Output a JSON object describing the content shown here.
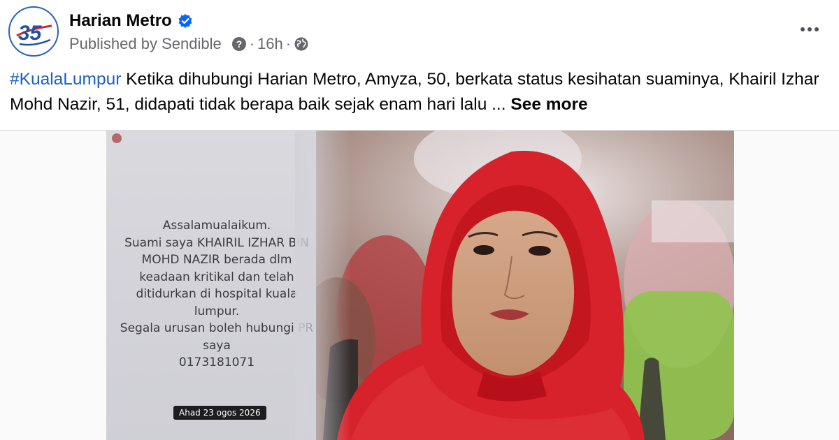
{
  "post": {
    "page_name": "Harian Metro",
    "publisher": "Published by Sendible",
    "time": "16h",
    "separator": "·",
    "logo_text": "35",
    "caption": {
      "hashtag": "#KualaLumpur",
      "text": " Ketika dihubungi Harian Metro, Amyza, 50, berkata status kesihatan suaminya, Khairil Izhar Mohd Nazir, 51, didapati tidak berapa baik sejak enam hari lalu ... ",
      "see_more": "See more"
    }
  },
  "story_card": {
    "lines": [
      "Assalamualaikum.",
      "Suami saya KHAIRIL IZHAR BIN",
      "MOHD NAZIR berada dlm",
      "keadaan kritikal dan telah",
      "ditidurkan di hospital kuala",
      "lumpur.",
      "Segala urusan boleh hubungi PR",
      "saya",
      "0173181071"
    ],
    "date_stamp": "Ahad 23 ogos 2026"
  },
  "colors": {
    "accent": "#1a5fc8",
    "hijab": "#d8222b",
    "verified": "#0866ff"
  },
  "icons": [
    "verified-badge-icon",
    "info-icon",
    "globe-icon",
    "more-options-icon"
  ]
}
